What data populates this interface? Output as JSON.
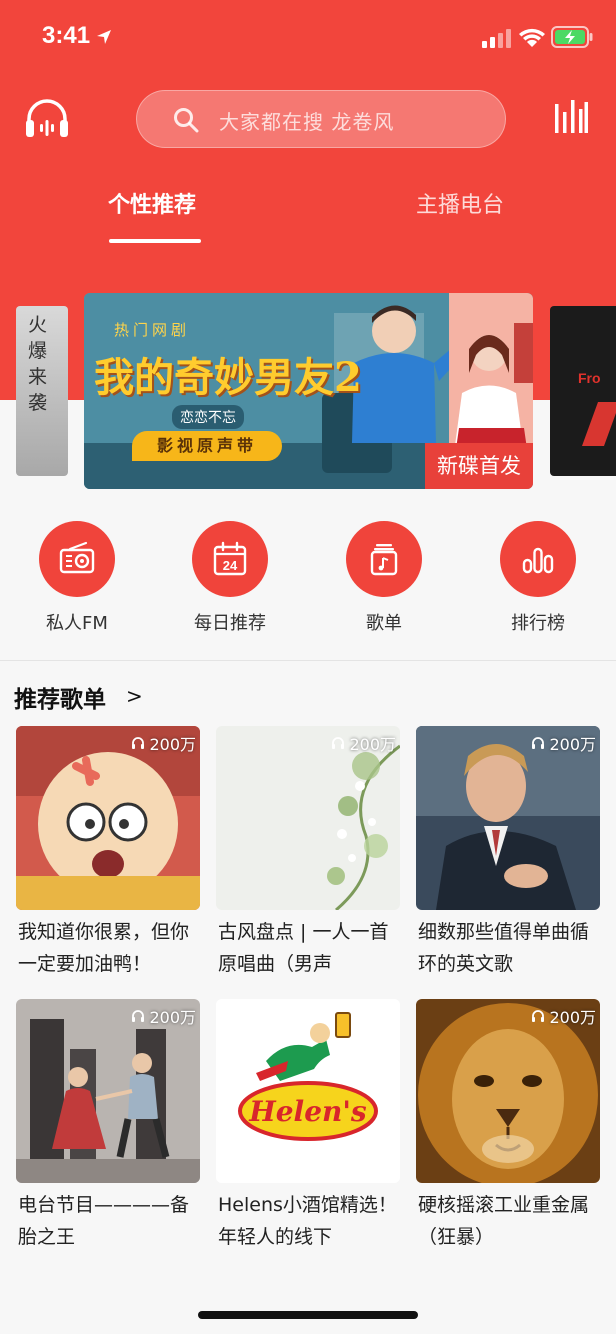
{
  "status_bar": {
    "time": "3:41"
  },
  "header": {
    "search_placeholder": "大家都在搜   龙卷风",
    "tabs": [
      {
        "label": "个性推荐",
        "active": true
      },
      {
        "label": "主播电台",
        "active": false
      }
    ]
  },
  "banner": {
    "left_peek_text": "火爆来袭",
    "right_peek_text": "Fro",
    "tag_top": "热门网剧",
    "title": "我的奇妙男友2",
    "subtitle": "恋恋不忘",
    "album_tag": "影视原声带",
    "badge": "新碟首发"
  },
  "quick_entries": [
    {
      "label": "私人FM",
      "icon": "radio-icon"
    },
    {
      "label": "每日推荐",
      "icon": "calendar-icon",
      "date": "24"
    },
    {
      "label": "歌单",
      "icon": "playlist-icon"
    },
    {
      "label": "排行榜",
      "icon": "chart-icon"
    }
  ],
  "section": {
    "title": "推荐歌单",
    "more": ">"
  },
  "playlists": [
    {
      "title": "我知道你很累，但你一定要加油鸭！",
      "play_count": "200万"
    },
    {
      "title": "古风盘点 | 一人一首原唱曲（男声",
      "play_count": "200万"
    },
    {
      "title": "细数那些值得单曲循环的英文歌",
      "play_count": "200万"
    },
    {
      "title": "电台节目————备胎之王",
      "play_count": "200万"
    },
    {
      "title": "Helens小酒馆精选！年轻人的线下",
      "play_count": "",
      "cover_text": "Helen's"
    },
    {
      "title": "硬核摇滚工业重金属（狂暴）",
      "play_count": "200万"
    }
  ],
  "colors": {
    "brand_red": "#f2453c",
    "background": "#f7f7f7"
  }
}
